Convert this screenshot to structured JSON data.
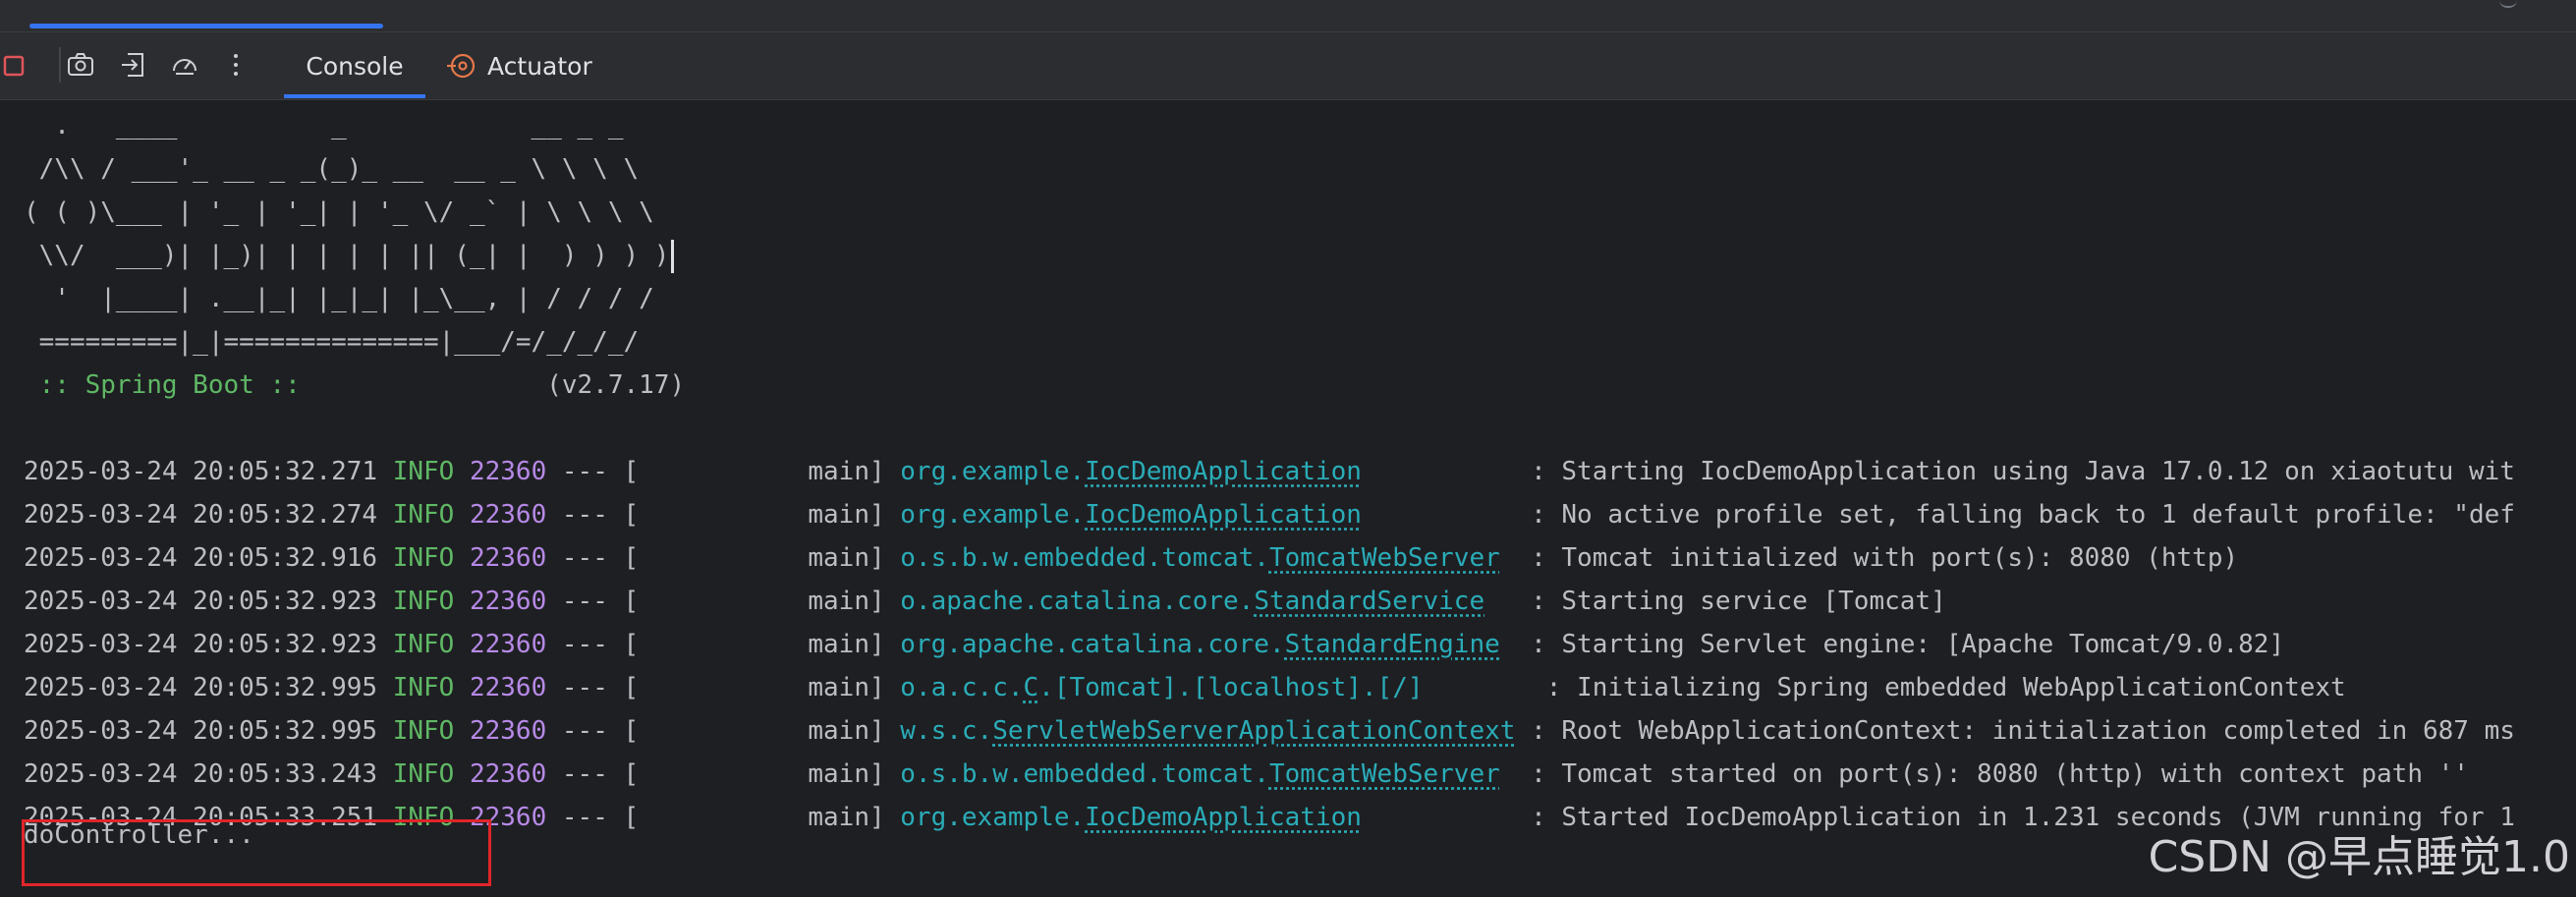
{
  "toolbar": {
    "tabs": [
      {
        "label": "Console",
        "active": true
      },
      {
        "label": "Actuator",
        "active": false
      }
    ],
    "icons": [
      "stop-icon",
      "camera-icon",
      "exit-icon",
      "gauge-icon",
      "more-icon"
    ]
  },
  "banner": [
    "  .   ____          _            __ _ _",
    " /\\\\ / ___'_ __ _ _(_)_ __  __ _ \\ \\ \\ \\",
    "( ( )\\___ | '_ | '_| | '_ \\/ _` | \\ \\ \\ \\",
    " \\\\/  ___)| |_)| | | | | || (_| |  ) ) ) )",
    "  '  |____| .__|_| |_|_| |_\\__, | / / / /",
    " =========|_|==============|___/=/_/_/_/"
  ],
  "spring_boot": {
    "label": " :: Spring Boot :: ",
    "version": "               (v2.7.17)"
  },
  "logs": [
    {
      "ts": "2025-03-24 20:05:32.271",
      "level": "INFO",
      "pid": "22360",
      "sep": " --- [",
      "thread": "           main] ",
      "pkg": "org.example.",
      "cls": "IocDemoApplication",
      "pad": "          ",
      "msg": " : Starting IocDemoApplication using Java 17.0.12 on xiaotutu wit"
    },
    {
      "ts": "2025-03-24 20:05:32.274",
      "level": "INFO",
      "pid": "22360",
      "sep": " --- [",
      "thread": "           main] ",
      "pkg": "org.example.",
      "cls": "IocDemoApplication",
      "pad": "          ",
      "msg": " : No active profile set, falling back to 1 default profile: \"def"
    },
    {
      "ts": "2025-03-24 20:05:32.916",
      "level": "INFO",
      "pid": "22360",
      "sep": " --- [",
      "thread": "           main] ",
      "pkg": "o.s.b.w.embedded.tomcat.",
      "cls": "TomcatWebServer",
      "pad": " ",
      "msg": " : Tomcat initialized with port(s): 8080 (http)"
    },
    {
      "ts": "2025-03-24 20:05:32.923",
      "level": "INFO",
      "pid": "22360",
      "sep": " --- [",
      "thread": "           main] ",
      "pkg": "o.apache.catalina.core.",
      "cls": "StandardService",
      "pad": "  ",
      "msg": " : Starting service [Tomcat]"
    },
    {
      "ts": "2025-03-24 20:05:32.923",
      "level": "INFO",
      "pid": "22360",
      "sep": " --- [",
      "thread": "           main] ",
      "pkg": "org.apache.catalina.core.",
      "cls": "StandardEngine",
      "pad": " ",
      "msg": " : Starting Servlet engine: [Apache Tomcat/9.0.82]"
    },
    {
      "ts": "2025-03-24 20:05:32.995",
      "level": "INFO",
      "pid": "22360",
      "sep": " --- [",
      "thread": "           main] ",
      "pkg": "o.a.c.c.",
      "cls": "C",
      "pad": ".[Tomcat].[localhost].[/]       ",
      "msg": " : Initializing Spring embedded WebApplicationContext"
    },
    {
      "ts": "2025-03-24 20:05:32.995",
      "level": "INFO",
      "pid": "22360",
      "sep": " --- [",
      "thread": "           main] ",
      "pkg": "w.s.c.",
      "cls": "ServletWebServerApplicationContext",
      "pad": "",
      "msg": " : Root WebApplicationContext: initialization completed in 687 ms"
    },
    {
      "ts": "2025-03-24 20:05:33.243",
      "level": "INFO",
      "pid": "22360",
      "sep": " --- [",
      "thread": "           main] ",
      "pkg": "o.s.b.w.embedded.tomcat.",
      "cls": "TomcatWebServer",
      "pad": " ",
      "msg": " : Tomcat started on port(s): 8080 (http) with context path ''"
    },
    {
      "ts": "2025-03-24 20:05:33.251",
      "level": "INFO",
      "pid": "22360",
      "sep": " --- [",
      "thread": "           main] ",
      "pkg": "org.example.",
      "cls": "IocDemoApplication",
      "pad": "          ",
      "msg": " : Started IocDemoApplication in 1.231 seconds (JVM running for 1"
    }
  ],
  "output_line": "doController...",
  "watermark": "CSDN @早点睡觉1.0",
  "colors": {
    "background": "#1e1f22",
    "toolbar": "#2b2d30",
    "info": "#5fb865",
    "pid": "#b689e6",
    "logger": "#2aacb8",
    "accent": "#3574f0",
    "highlight": "#e0252a"
  }
}
